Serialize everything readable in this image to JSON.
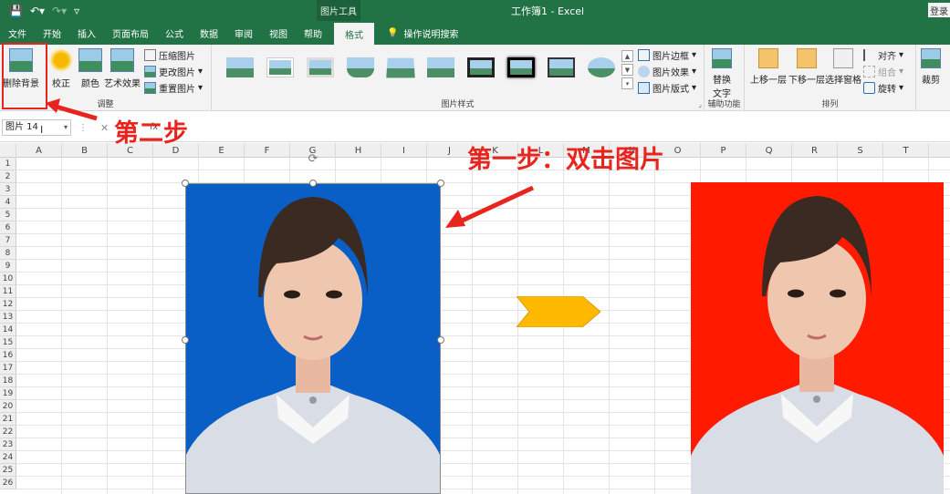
{
  "titlebar": {
    "context_tab": "图片工具",
    "window_title": "工作簿1  -  Excel",
    "login": "登录"
  },
  "tabs": [
    "文件",
    "开始",
    "插入",
    "页面布局",
    "公式",
    "数据",
    "审阅",
    "视图",
    "帮助"
  ],
  "active_tab": "格式",
  "tell_me": "操作说明搜索",
  "ribbon": {
    "adjust": {
      "remove_bg": "删除背景",
      "corrections": "校正",
      "color": "颜色",
      "artistic": "艺术效果",
      "compress": "压缩图片",
      "change": "更改图片",
      "reset": "重置图片",
      "label": "调整"
    },
    "styles": {
      "border": "图片边框",
      "effects": "图片效果",
      "layout": "图片版式",
      "label": "图片样式"
    },
    "accessibility": {
      "alt_text_l1": "替换",
      "alt_text_l2": "文字",
      "label": "辅助功能"
    },
    "arrange": {
      "bring_forward": "上移一层",
      "send_backward": "下移一层",
      "selection_pane": "选择窗格",
      "align": "对齐",
      "group": "组合",
      "rotate": "旋转",
      "label": "排列"
    },
    "size": {
      "crop": "裁剪"
    }
  },
  "formula_bar": {
    "name_box": "图片 14",
    "fx": "fx"
  },
  "columns": [
    "A",
    "B",
    "C",
    "D",
    "E",
    "F",
    "G",
    "H",
    "I",
    "J",
    "K",
    "L",
    "M",
    "N",
    "O",
    "P",
    "Q",
    "R",
    "S",
    "T"
  ],
  "rows": [
    "1",
    "2",
    "3",
    "4",
    "5",
    "6",
    "7",
    "8",
    "9",
    "10",
    "11",
    "12",
    "13",
    "14",
    "15",
    "16",
    "17",
    "18",
    "19",
    "20",
    "21",
    "22",
    "23",
    "24",
    "25",
    "26"
  ],
  "annotations": {
    "step2": "第二步",
    "step1": "第一步：双击图片"
  },
  "colors": {
    "excel_green": "#217346",
    "highlight_red": "#e8241e",
    "photo_left_bg": "#0a5fc6",
    "photo_right_bg": "#ff1a00",
    "arrow_yellow": "#ffb900"
  }
}
